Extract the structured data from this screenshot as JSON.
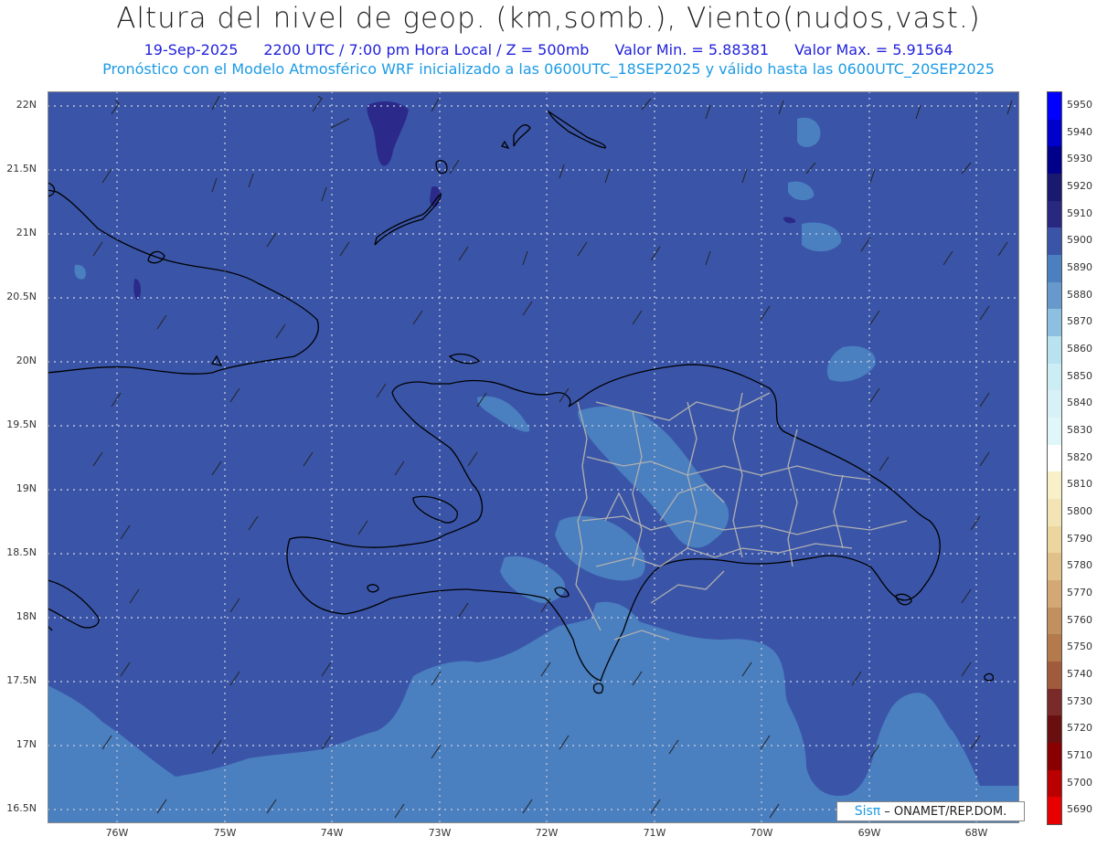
{
  "header": {
    "title": "Altura del nivel de geop. (km,somb.), Viento(nudos,vast.)",
    "date": "19-Sep-2025",
    "time": "2200 UTC / 7:00 pm Hora Local / Z = 500mb",
    "min": "Valor Min. = 5.88381",
    "max": "Valor Max. = 5.91564",
    "subtitle": "Pronóstico con el Modelo Atmosférico WRF inicializado a las 0600UTC_18SEP2025 y válido hasta las  0600UTC_20SEP2025"
  },
  "lat_labels": [
    "22N",
    "21.5N",
    "21N",
    "20.5N",
    "20N",
    "19.5N",
    "19N",
    "18.5N",
    "18N",
    "17.5N",
    "17N",
    "16.5N"
  ],
  "lon_labels": [
    "76W",
    "75W",
    "74W",
    "73W",
    "72W",
    "71W",
    "70W",
    "69W",
    "68W"
  ],
  "colorbar": {
    "labels": [
      "5950",
      "5940",
      "5930",
      "5920",
      "5910",
      "5900",
      "5890",
      "5880",
      "5870",
      "5860",
      "5850",
      "5840",
      "5830",
      "5820",
      "5810",
      "5800",
      "5790",
      "5780",
      "5770",
      "5760",
      "5750",
      "5740",
      "5730",
      "5720",
      "5710",
      "5700",
      "5690"
    ],
    "colors": [
      "#0000ff",
      "#0000cc",
      "#00008b",
      "#191970",
      "#282880",
      "#3a55a8",
      "#4a7fc0",
      "#6899cc",
      "#8cbfe0",
      "#b8e2f0",
      "#cdedf5",
      "#d8f1f6",
      "#e0f6f8",
      "#ffffff",
      "#f8f0c8",
      "#f2e4b4",
      "#ecd6a0",
      "#e2c08a",
      "#d4a874",
      "#c2905e",
      "#b47a4c",
      "#a05a3c",
      "#7a2a28",
      "#6a0f10",
      "#8a0000",
      "#bb0000",
      "#e80000"
    ]
  },
  "credit": {
    "logo": "Sisπ",
    "text": "– ONAMET/REP.DOM."
  },
  "colors": {
    "base": "#3a55a8",
    "light": "#4a7fc0",
    "dark": "#2b2a8a"
  }
}
